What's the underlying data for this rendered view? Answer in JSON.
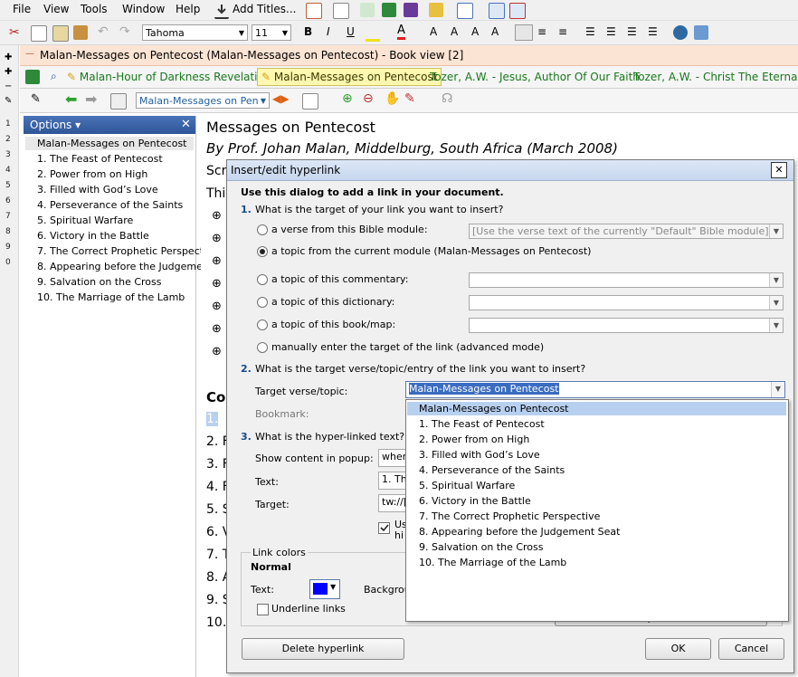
{
  "menu": {
    "file": "File",
    "view": "View",
    "tools": "Tools",
    "window": "Window",
    "help": "Help",
    "add_titles": "Add Titles..."
  },
  "format_bar": {
    "font_name": "Tahoma",
    "font_size": "11"
  },
  "book_header": "Malan-Messages on Pentecost (Malan-Messages on Pentecost) - Book view [2]",
  "tabs": [
    {
      "label": "Malan-Hour of Darkness Revelation"
    },
    {
      "label": "Malan-Messages on Pentecost"
    },
    {
      "label": "Tozer, A.W. - Jesus, Author Of Our Faith"
    },
    {
      "label": "Tozer, A.W. - Christ The Eternal Sor"
    }
  ],
  "nav_combo": "Malan-Messages on Pen",
  "gutter_numbers": [
    "1",
    "2",
    "3",
    "4",
    "5",
    "6",
    "7",
    "8",
    "9",
    "0"
  ],
  "options_panel": {
    "title": "Options",
    "items": [
      "Malan-Messages on Pentecost",
      "1. The Feast of Pentecost",
      "2. Power from on High",
      "3. Filled with God’s Love",
      "4. Perseverance of the Saints",
      "5. Spiritual Warfare",
      "6. Victory in the Battle",
      "7. The Correct Prophetic Perspective",
      "8. Appearing before the Judgement Seat",
      "9. Salvation on the Cross",
      "10. The Marriage of the Lamb"
    ]
  },
  "document": {
    "title": "Messages on Pentecost",
    "subtitle": "By Prof. Johan Malan, Middelburg, South Africa (March 2008)",
    "line_scr": "Scr",
    "line_thi": "Thi",
    "contents_fragment": "Cor",
    "list_fragments": [
      "1.",
      "2. F",
      "3. F",
      "4. F",
      "5. S",
      "6. V",
      "7. T",
      "8. A",
      "9. S",
      "10."
    ]
  },
  "dialog": {
    "title": "Insert/edit hyperlink",
    "intro": "Use this dialog to add a link in your document.",
    "q1": "What is the target of your link you want to insert?",
    "opt_verse": "a verse from this Bible module:",
    "opt_verse_combo": "[Use the verse text of the currently \"Default\" Bible module]",
    "opt_topic_module": "a topic from the current module (Malan-Messages on Pentecost)",
    "opt_commentary": "a topic of this commentary:",
    "opt_dictionary": "a topic of this dictionary:",
    "opt_book": "a topic of this book/map:",
    "opt_manual": "manually enter the target of the link (advanced mode)",
    "q2": "What is the target verse/topic/entry of the link you want to insert?",
    "target_label": "Target verse/topic:",
    "target_value": "Malan-Messages on Pentecost",
    "bookmark_label": "Bookmark:",
    "q3": "What is the hyper-linked text? (t",
    "show_popup_label": "Show content in popup:",
    "show_popup_value": "wher",
    "text_label": "Text:",
    "text_value": "1. The",
    "target2_label": "Target:",
    "target2_value": "tw://[",
    "use_fragment": "Us",
    "hi_fragment": "hi",
    "link_colors_label": "Link colors",
    "normal_label": "Normal",
    "color_text_label": "Text:",
    "background_label": "Backgrou",
    "underline_label": "Underline links",
    "set_default_fragment": "Set these options as default",
    "delete_button": "Delete hyperlink",
    "ok_button": "OK",
    "cancel_button": "Cancel",
    "num1": "1.",
    "num2": "2.",
    "num3": "3."
  },
  "dropdown": {
    "items": [
      "Malan-Messages on Pentecost",
      "1. The Feast of Pentecost",
      "2. Power from on High",
      "3. Filled with God’s Love",
      "4. Perseverance of the Saints",
      "5. Spiritual Warfare",
      "6. Victory in the Battle",
      "7. The Correct Prophetic Perspective",
      "8. Appearing before the Judgement Seat",
      "9. Salvation on the Cross",
      "10. The Marriage of the Lamb"
    ]
  },
  "colors": {
    "accent_blue": "#2e5597",
    "tab_green": "#18781c",
    "selection": "#b8d0f0",
    "link_color": "#0000ff"
  }
}
